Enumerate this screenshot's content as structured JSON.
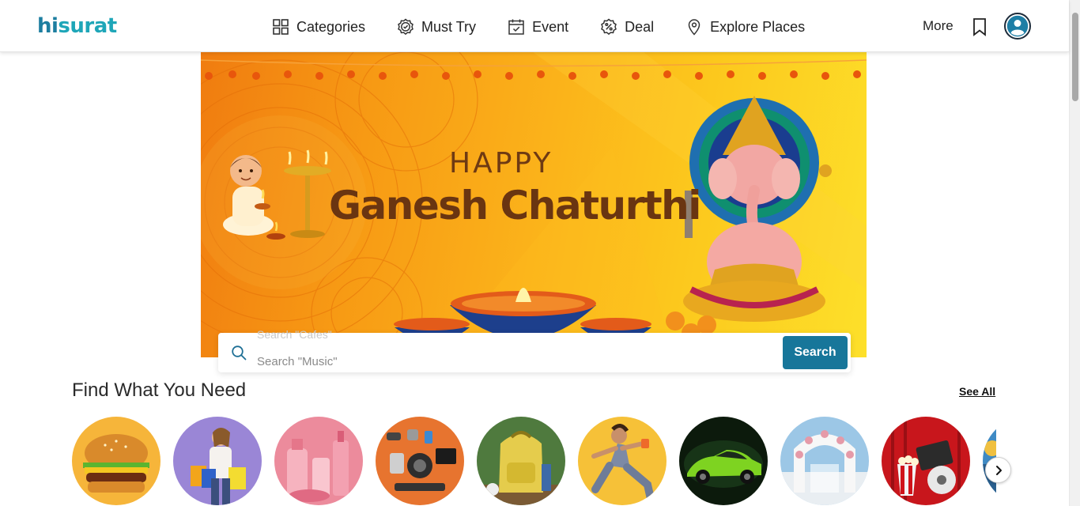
{
  "brand": {
    "logo_hi": "hi",
    "logo_rest": "surat"
  },
  "nav": {
    "items": [
      {
        "label": "Categories",
        "icon": "grid-icon"
      },
      {
        "label": "Must Try",
        "icon": "badge-check-icon"
      },
      {
        "label": "Event",
        "icon": "calendar-check-icon"
      },
      {
        "label": "Deal",
        "icon": "percent-badge-icon"
      },
      {
        "label": "Explore Places",
        "icon": "map-pin-icon"
      }
    ],
    "more_label": "More"
  },
  "banner": {
    "line1": "HAPPY",
    "line2": "Ganesh Chaturthi"
  },
  "search": {
    "ghost_text": "Search \"Cafes\"",
    "placeholder": "Search \"Music\"",
    "button_label": "Search"
  },
  "find": {
    "title": "Find What You Need",
    "see_all": "See All",
    "categories": [
      {
        "icon": "burger-image"
      },
      {
        "icon": "shopping-image"
      },
      {
        "icon": "beauty-products-image"
      },
      {
        "icon": "electronics-image"
      },
      {
        "icon": "backpack-image"
      },
      {
        "icon": "fitness-image"
      },
      {
        "icon": "sports-car-image"
      },
      {
        "icon": "wedding-venue-image"
      },
      {
        "icon": "movies-image"
      },
      {
        "icon": "travel-image"
      }
    ]
  },
  "colors": {
    "brand_teal": "#1ea6b8",
    "brand_blue": "#1d7ea0",
    "button": "#17769a",
    "banner_orange": "#f07c10",
    "banner_yellow": "#fde02a"
  }
}
